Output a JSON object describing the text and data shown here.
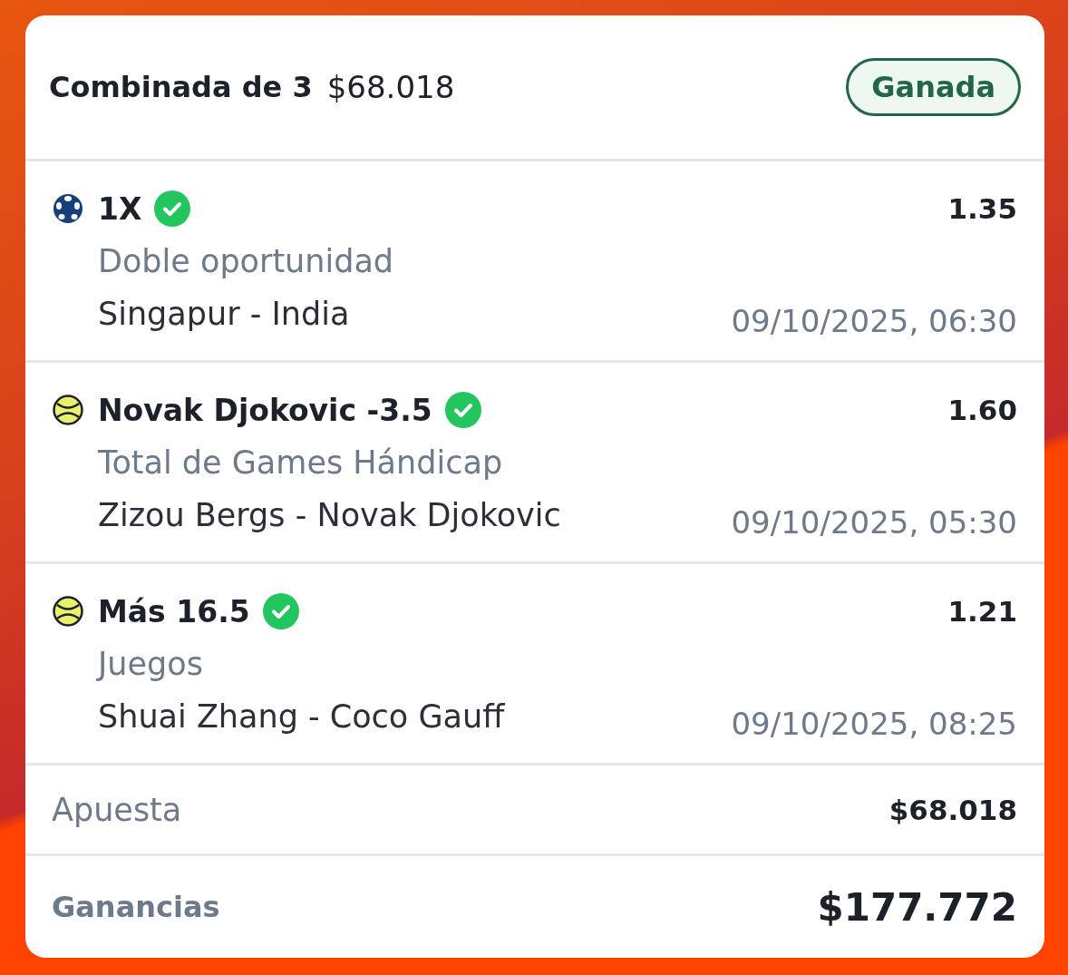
{
  "bet": {
    "title": "Combinada de 3",
    "stake": "$68.018",
    "status": {
      "label": "Ganada",
      "kind": "won"
    }
  },
  "selections": [
    {
      "kind": "soccer",
      "pick": "1X",
      "won": true,
      "odds": "1.35",
      "market": "Doble oportunidad",
      "event": "Singapur - India",
      "datetime": "09/10/2025, 06:30"
    },
    {
      "kind": "tennis",
      "pick": "Novak Djokovic -3.5",
      "won": true,
      "odds": "1.60",
      "market": "Total de Games Hándicap",
      "event": "Zizou Bergs - Novak Djokovic",
      "datetime": "09/10/2025, 05:30"
    },
    {
      "kind": "tennis",
      "pick": "Más 16.5",
      "won": true,
      "odds": "1.21",
      "market": "Juegos",
      "event": "Shuai Zhang - Coco Gauff",
      "datetime": "09/10/2025, 08:25"
    }
  ],
  "summary": [
    {
      "kind": "stake",
      "label": "Apuesta",
      "value": "$68.018"
    },
    {
      "kind": "winnings",
      "label": "Ganancias",
      "value": "$177.772"
    }
  ]
}
